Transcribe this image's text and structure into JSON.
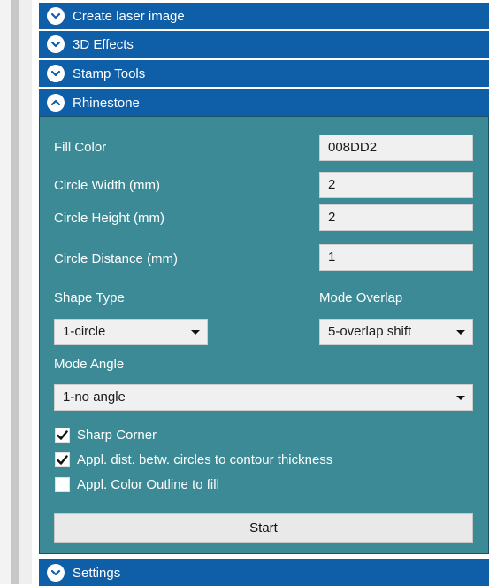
{
  "accordion": {
    "sections": [
      {
        "label": "Create laser image",
        "expanded": false
      },
      {
        "label": "3D Effects",
        "expanded": false
      },
      {
        "label": "Stamp Tools",
        "expanded": false
      },
      {
        "label": "Rhinestone",
        "expanded": true
      },
      {
        "label": "Settings",
        "expanded": false
      }
    ]
  },
  "rhinestone": {
    "fill_color": {
      "label": "Fill Color",
      "value": "008DD2"
    },
    "circle_width": {
      "label": "Circle Width (mm)",
      "value": "2"
    },
    "circle_height": {
      "label": "Circle Height (mm)",
      "value": "2"
    },
    "circle_distance": {
      "label": "Circle Distance (mm)",
      "value": "1"
    },
    "shape_type": {
      "label": "Shape Type",
      "value": "1-circle"
    },
    "mode_overlap": {
      "label": "Mode Overlap",
      "value": "5-overlap shift"
    },
    "mode_angle": {
      "label": "Mode Angle",
      "value": "1-no angle"
    },
    "checkboxes": [
      {
        "label": "Sharp Corner",
        "checked": true
      },
      {
        "label": "Appl. dist. betw. circles to contour thickness",
        "checked": true
      },
      {
        "label": "Appl. Color Outline to fill",
        "checked": false
      }
    ],
    "start_label": "Start"
  },
  "colors": {
    "header_bg": "#0f5ea8",
    "panel_bg": "#3c8a96",
    "input_bg": "#f0f0f0"
  }
}
